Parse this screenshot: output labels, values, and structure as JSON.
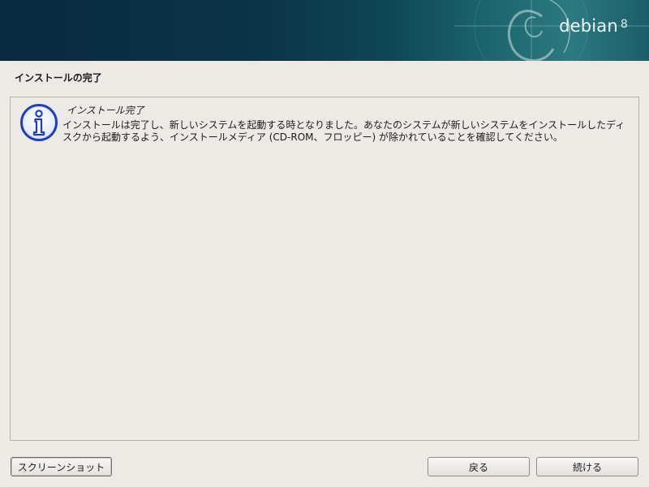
{
  "banner": {
    "brand": "debian",
    "version": "8"
  },
  "page": {
    "title": "インストールの完了"
  },
  "message": {
    "icon": "info-icon",
    "title": "インストール完了",
    "body": "インストールは完了し、新しいシステムを起動する時となりました。あなたのシステムが新しいシステムをインストールしたディスクから起動するよう、インストールメディア (CD-ROM、フロッピー) が除かれていることを確認してください。"
  },
  "buttons": {
    "screenshot": "スクリーンショット",
    "back": "戻る",
    "continue": "続ける"
  },
  "colors": {
    "banner_dark": "#0a2a3f",
    "banner_teal": "#2b7a80",
    "background": "#edeae6",
    "info_blue": "#1f3fbf"
  }
}
